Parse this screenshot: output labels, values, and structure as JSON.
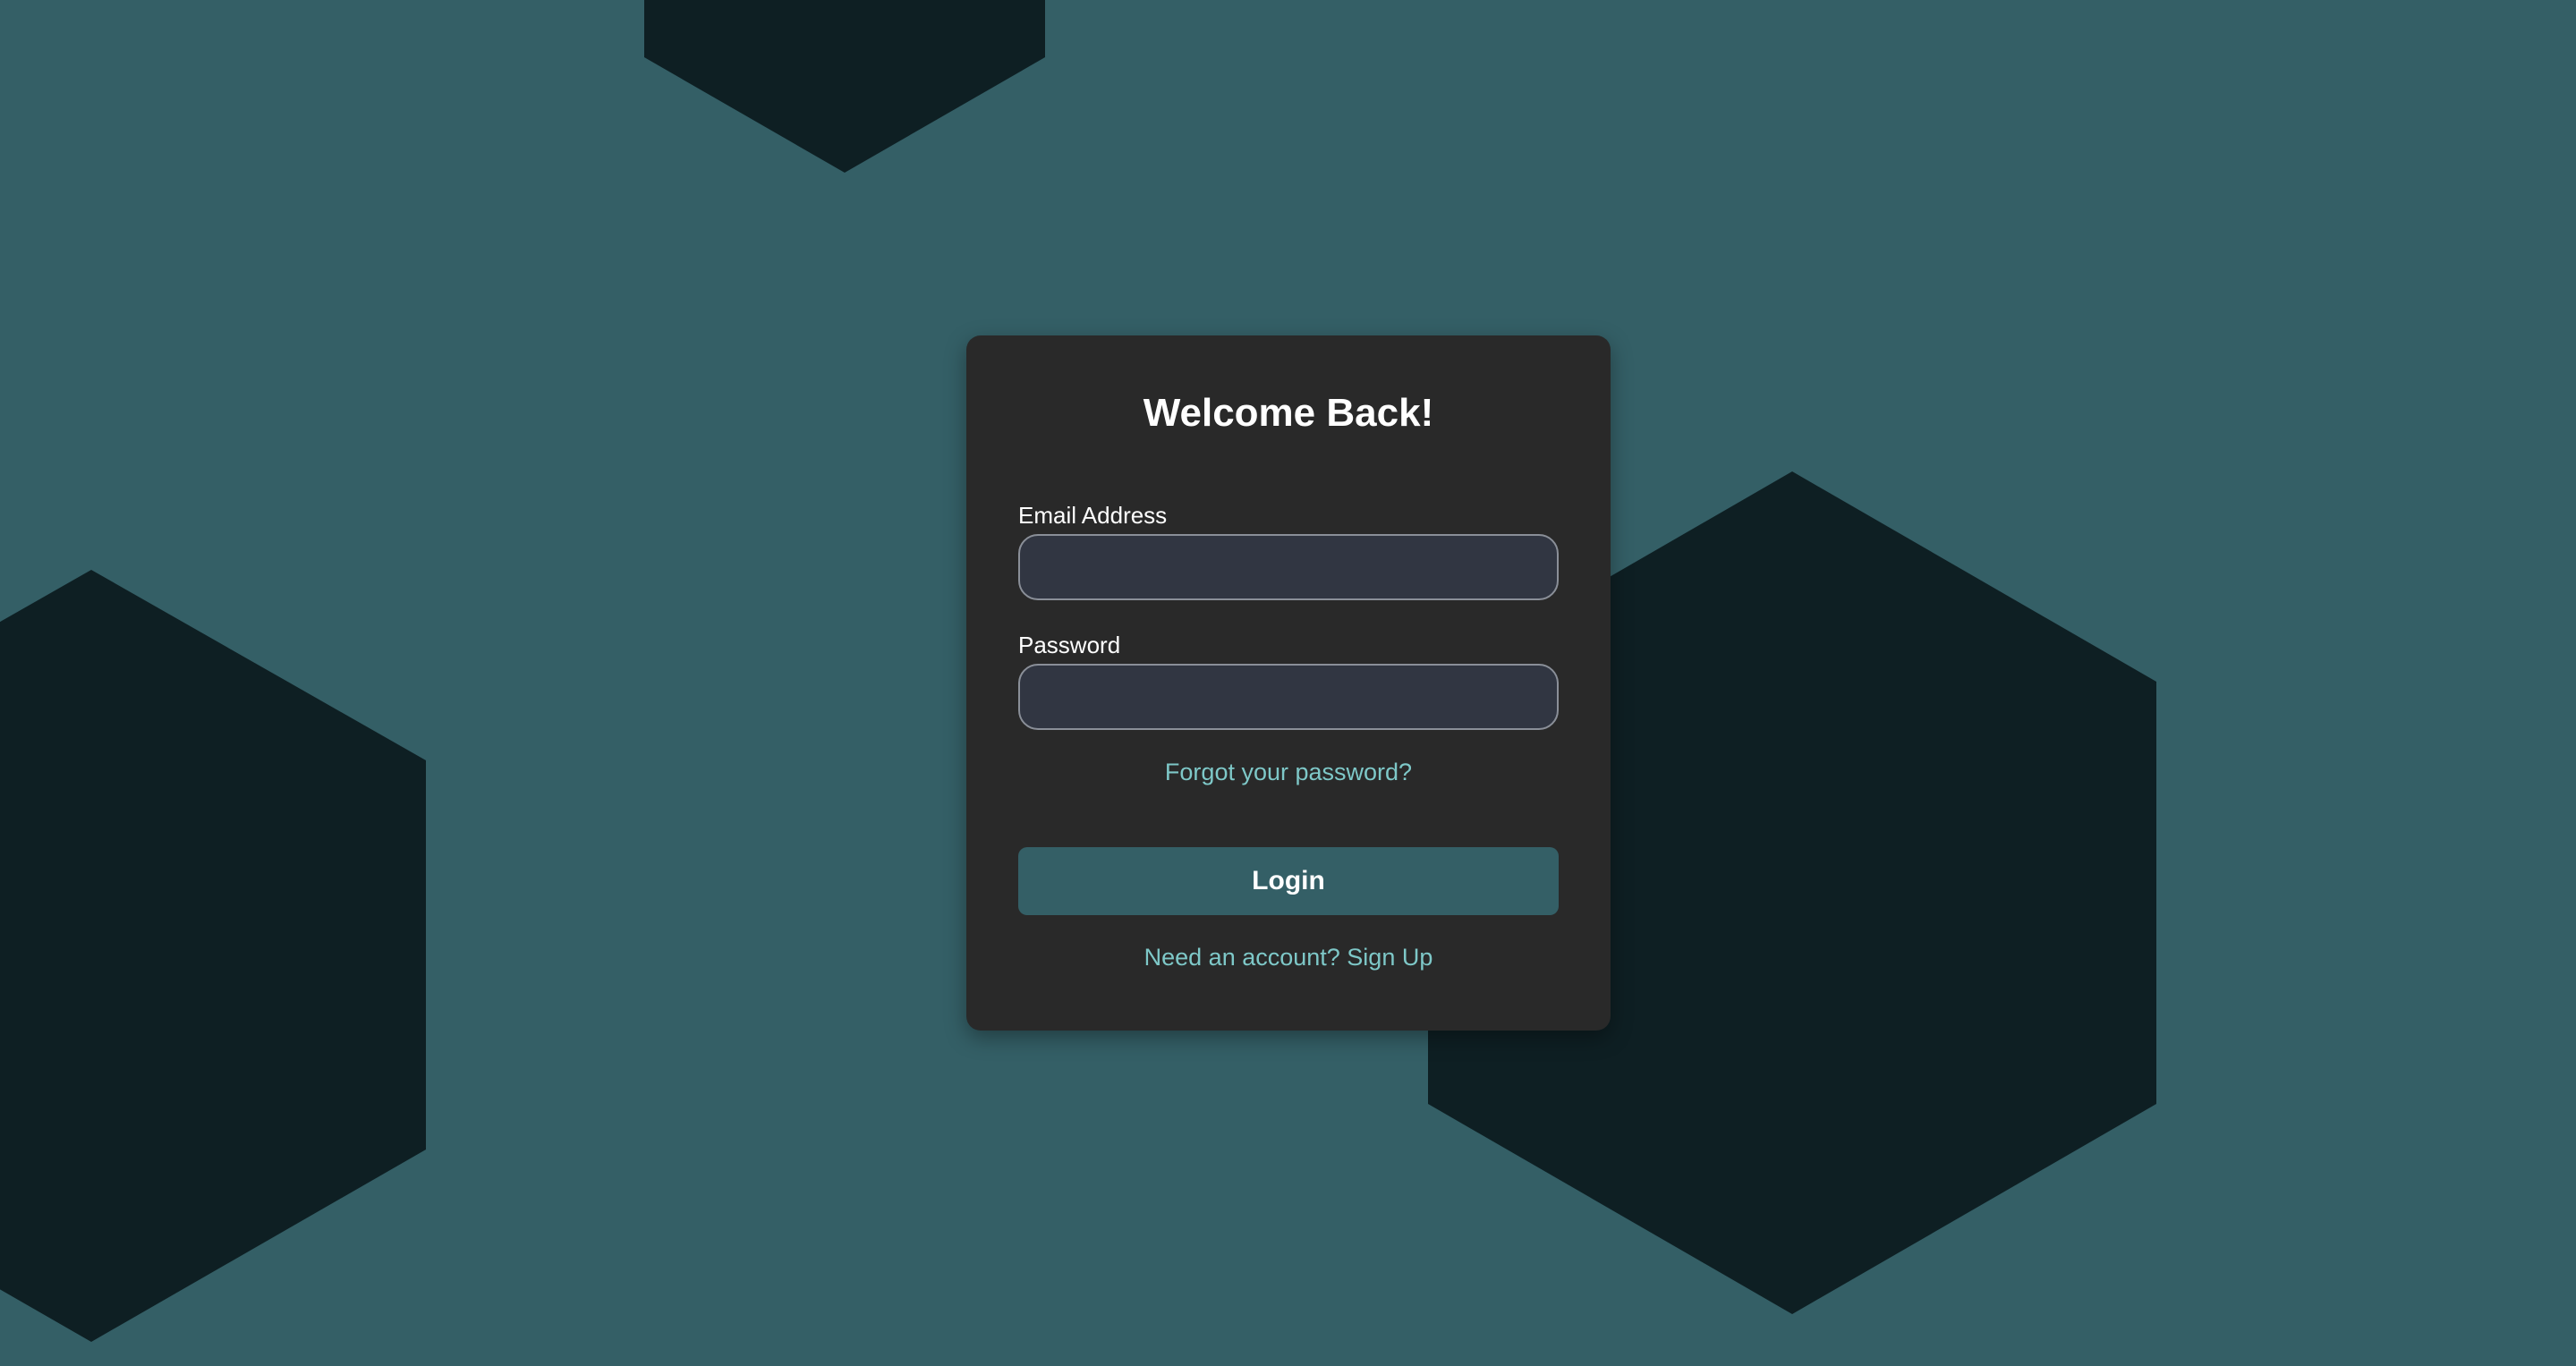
{
  "login": {
    "title": "Welcome Back!",
    "email_label": "Email Address",
    "email_value": "",
    "password_label": "Password",
    "password_value": "",
    "forgot_link": "Forgot your password?",
    "login_button": "Login",
    "signup_link": "Need an account? Sign Up"
  },
  "colors": {
    "background": "#345f66",
    "hexagons": "#0e1f23",
    "card": "#292929",
    "input_fill": "#313642",
    "input_border": "#8a8f98",
    "link": "#7ec8c8",
    "button": "#345f66",
    "text": "#ffffff"
  }
}
